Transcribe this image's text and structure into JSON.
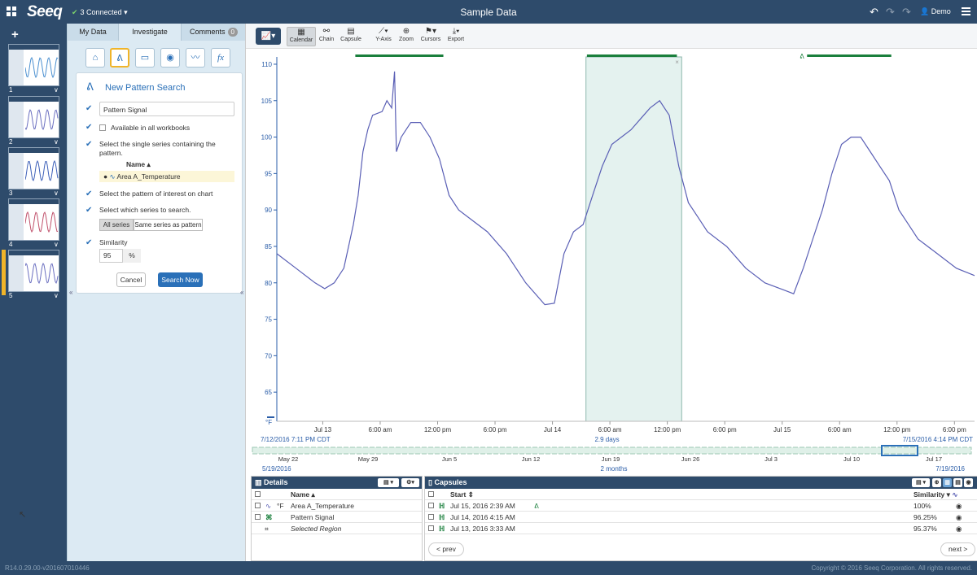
{
  "topbar": {
    "logo": "Seeq",
    "connected": "3 Connected",
    "title": "Sample Data",
    "user": "Demo"
  },
  "worksheets": [
    {
      "number": "1"
    },
    {
      "number": "2"
    },
    {
      "number": "3"
    },
    {
      "number": "4"
    },
    {
      "number": "5",
      "selected": true
    }
  ],
  "tabs": {
    "my_data": "My Data",
    "investigate": "Investigate",
    "comments": "Comments",
    "comments_count": "0"
  },
  "tool_icons": [
    "home-icon",
    "pattern-icon",
    "periodic-condition-icon",
    "visibility-icon",
    "signal-icon",
    "formula-icon"
  ],
  "formula_glyph": "fx",
  "pattern_search": {
    "title": "New Pattern Search",
    "name_value": "Pattern Signal",
    "available_label": "Available in all workbooks",
    "step_series": "Select the single series containing the pattern.",
    "name_header": "Name",
    "selected_series": "Area A_Temperature",
    "step_pattern": "Select the pattern of interest on chart",
    "step_search": "Select which series to search.",
    "btn_all_series": "All series",
    "btn_same_series": "Same series as pattern",
    "similarity_label": "Similarity",
    "similarity_value": "95",
    "similarity_unit": "%",
    "cancel": "Cancel",
    "search_now": "Search Now"
  },
  "toolbar": {
    "calendar": "Calendar",
    "chain": "Chain",
    "capsule": "Capsule",
    "yaxis": "Y-Axis",
    "zoom": "Zoom",
    "cursors": "Cursors",
    "export": "Export"
  },
  "chart_data": {
    "type": "line",
    "ylim": [
      61,
      111
    ],
    "yticks": [
      65,
      70,
      75,
      80,
      85,
      90,
      95,
      100,
      105,
      110
    ],
    "yunit": "°F",
    "xlim": [
      0,
      72.9
    ],
    "xticks": [
      {
        "t": 4.8,
        "label": "Jul 13"
      },
      {
        "t": 10.8,
        "label": "6:00 am"
      },
      {
        "t": 16.8,
        "label": "12:00 pm"
      },
      {
        "t": 22.8,
        "label": "6:00 pm"
      },
      {
        "t": 28.8,
        "label": "Jul 14"
      },
      {
        "t": 34.8,
        "label": "6:00 am"
      },
      {
        "t": 40.8,
        "label": "12:00 pm"
      },
      {
        "t": 46.8,
        "label": "6:00 pm"
      },
      {
        "t": 52.8,
        "label": "Jul 15"
      },
      {
        "t": 58.8,
        "label": "6:00 am"
      },
      {
        "t": 64.8,
        "label": "12:00 pm"
      },
      {
        "t": 70.8,
        "label": "6:00 pm"
      }
    ],
    "range_start": "7/12/2016 7:11 PM CDT",
    "range_duration": "2.9 days",
    "range_end": "7/15/2016 4:14 PM CDT",
    "selected_region": [
      32.3,
      42.3
    ],
    "capsule_bars": [
      [
        8.2,
        17.4
      ],
      [
        32.4,
        41.8
      ],
      [
        55.4,
        64.2
      ]
    ],
    "series": [
      {
        "name": "Area A_Temperature",
        "color": "#5a5fb5",
        "points": [
          [
            0,
            84
          ],
          [
            2,
            82
          ],
          [
            4,
            80
          ],
          [
            5,
            79.2
          ],
          [
            6,
            80
          ],
          [
            7,
            82
          ],
          [
            8,
            88
          ],
          [
            8.5,
            92
          ],
          [
            9,
            98
          ],
          [
            9.5,
            101
          ],
          [
            10,
            103
          ],
          [
            11,
            103.5
          ],
          [
            11.5,
            105
          ],
          [
            12,
            104
          ],
          [
            12.3,
            109
          ],
          [
            12.5,
            98
          ],
          [
            13,
            100
          ],
          [
            13.5,
            101
          ],
          [
            14,
            102
          ],
          [
            15,
            102
          ],
          [
            16,
            100
          ],
          [
            17,
            97
          ],
          [
            18,
            92
          ],
          [
            19,
            90
          ],
          [
            20,
            89
          ],
          [
            22,
            87
          ],
          [
            24,
            84
          ],
          [
            26,
            80
          ],
          [
            28,
            77
          ],
          [
            29,
            77.2
          ],
          [
            30,
            84
          ],
          [
            31,
            87
          ],
          [
            32,
            88
          ],
          [
            33,
            92
          ],
          [
            34,
            96
          ],
          [
            35,
            99
          ],
          [
            36,
            100
          ],
          [
            37,
            101
          ],
          [
            38,
            102.5
          ],
          [
            39,
            104
          ],
          [
            40,
            105
          ],
          [
            41,
            103
          ],
          [
            42,
            96
          ],
          [
            43,
            91
          ],
          [
            44,
            89
          ],
          [
            45,
            87
          ],
          [
            47,
            85
          ],
          [
            49,
            82
          ],
          [
            51,
            80
          ],
          [
            53,
            79
          ],
          [
            54,
            78.5
          ],
          [
            55,
            82
          ],
          [
            56,
            86
          ],
          [
            57,
            90
          ],
          [
            58,
            95
          ],
          [
            59,
            99
          ],
          [
            60,
            100
          ],
          [
            61,
            100
          ],
          [
            62,
            98
          ],
          [
            63,
            96
          ],
          [
            64,
            94
          ],
          [
            65,
            90
          ],
          [
            66,
            88
          ],
          [
            67,
            86
          ],
          [
            69,
            84
          ],
          [
            71,
            82
          ],
          [
            72.9,
            81
          ]
        ]
      }
    ]
  },
  "navigator": {
    "ticks": [
      "May 22",
      "May 29",
      "Jun 5",
      "Jun 12",
      "Jun 19",
      "Jun 26",
      "Jul 3",
      "Jul 10",
      "Jul 17"
    ],
    "start": "5/19/2016",
    "duration": "2 months",
    "end": "7/19/2016"
  },
  "details": {
    "title": "Details",
    "name_header": "Name",
    "rows": [
      {
        "unit": "°F",
        "name": "Area A_Temperature"
      },
      {
        "unit": "",
        "name": "Pattern Signal"
      },
      {
        "unit": "",
        "name": "Selected Region"
      }
    ]
  },
  "capsules": {
    "title": "Capsules",
    "start_header": "Start",
    "similarity_header": "Similarity",
    "rows": [
      {
        "start": "Jul 15, 2016 2:39 AM",
        "similarity": "100%"
      },
      {
        "start": "Jul 14, 2016 4:15 AM",
        "similarity": "96.25%"
      },
      {
        "start": "Jul 13, 2016 3:33 AM",
        "similarity": "95.37%"
      }
    ],
    "prev": "< prev",
    "next": "next >"
  },
  "footer": {
    "version": "R14.0.29.00-v201607010446",
    "copyright": "Copyright © 2016 Seeq Corporation. All rights reserved."
  },
  "colors": {
    "navy": "#2e4b6b",
    "accent_blue": "#2a70b8",
    "capsule_green": "#1a7f3c",
    "selection_teal": "#e4f2ef",
    "series_purple": "#5a5fb5",
    "highlight_orange": "#f0b429"
  }
}
